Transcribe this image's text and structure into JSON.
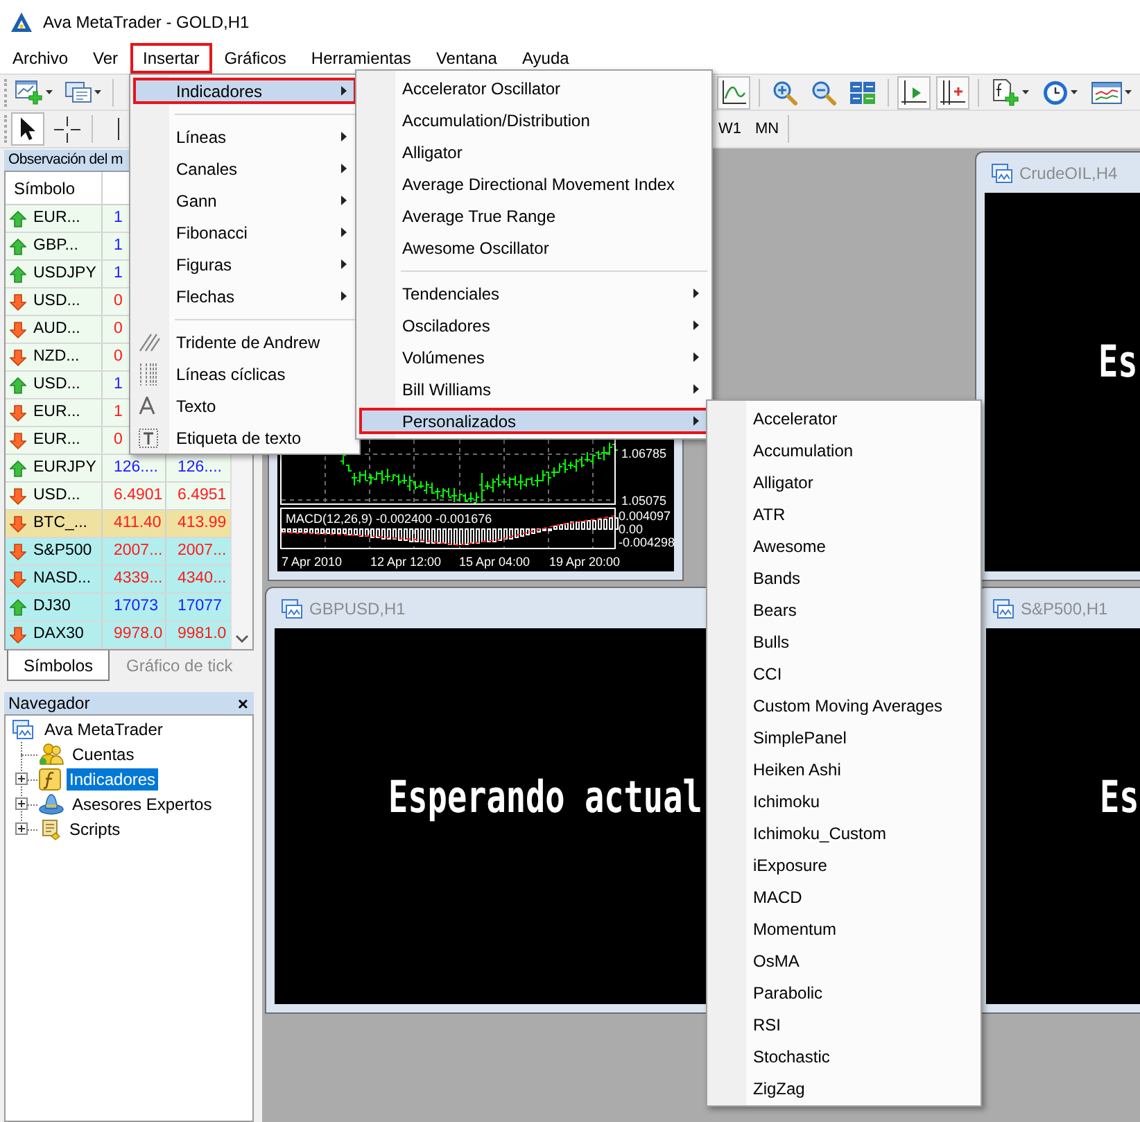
{
  "window": {
    "title": "Ava MetaTrader - GOLD,H1"
  },
  "menu_bar": [
    {
      "label": "Archivo",
      "selected": false
    },
    {
      "label": "Ver",
      "selected": false
    },
    {
      "label": "Insertar",
      "selected": true
    },
    {
      "label": "Gráficos",
      "selected": false
    },
    {
      "label": "Herramientas",
      "selected": false
    },
    {
      "label": "Ventana",
      "selected": false
    },
    {
      "label": "Ayuda",
      "selected": false
    }
  ],
  "toolbar": {
    "left": [
      {
        "kind": "new_chart",
        "on": false,
        "dropdown": true
      },
      {
        "kind": "profiles",
        "on": false,
        "dropdown": true
      },
      {
        "kind": "separator"
      }
    ],
    "right": [
      {
        "kind": "line_chart",
        "on": true,
        "dropdown": false
      },
      {
        "kind": "separator"
      },
      {
        "kind": "zoom_in",
        "on": false,
        "dropdown": false
      },
      {
        "kind": "zoom_out",
        "on": false,
        "dropdown": false
      },
      {
        "kind": "tile",
        "on": false,
        "dropdown": false
      },
      {
        "kind": "separator"
      },
      {
        "kind": "autoscroll",
        "on": true,
        "dropdown": false
      },
      {
        "kind": "chart_shift",
        "on": true,
        "dropdown": false
      },
      {
        "kind": "separator"
      },
      {
        "kind": "indicators",
        "on": false,
        "dropdown": true
      },
      {
        "kind": "periods",
        "on": false,
        "dropdown": true
      },
      {
        "kind": "templates",
        "on": false,
        "dropdown": true
      }
    ]
  },
  "tools_toolbar": {
    "tools": [
      {
        "kind": "cursor",
        "selected": true
      },
      {
        "kind": "crosshair",
        "selected": false
      },
      {
        "kind": "separator"
      },
      {
        "kind": "vertical_line",
        "selected": false
      }
    ],
    "timeframes": [
      {
        "label": "W1",
        "selected": false
      },
      {
        "label": "MN",
        "selected": false
      }
    ]
  },
  "market_watch": {
    "title": "Observación del m",
    "columns": [
      "Símbolo"
    ],
    "rows": [
      {
        "symbol": "EUR...",
        "rising": true,
        "bid": "1",
        "color": "#effaef"
      },
      {
        "symbol": "GBP...",
        "rising": true,
        "bid": "1",
        "color": "#effaef"
      },
      {
        "symbol": "USDJPY",
        "rising": true,
        "bid": "1",
        "color": "#effaef"
      },
      {
        "symbol": "USD...",
        "rising": false,
        "bid": "0",
        "color": "#effaef"
      },
      {
        "symbol": "AUD...",
        "rising": false,
        "bid": "0",
        "color": "#effaef"
      },
      {
        "symbol": "NZD...",
        "rising": false,
        "bid": "0",
        "color": "#effaef"
      },
      {
        "symbol": "USD...",
        "rising": true,
        "bid": "1",
        "color": "#effaef"
      },
      {
        "symbol": "EUR...",
        "rising": false,
        "bid": "1",
        "color": "#effaef"
      },
      {
        "symbol": "EUR...",
        "rising": false,
        "bid": "0",
        "color": "#effaef"
      },
      {
        "symbol": "EURJPY",
        "rising": true,
        "bid": "126....",
        "ask": "126....",
        "color": "#effaef"
      },
      {
        "symbol": "USD...",
        "rising": false,
        "bid": "6.4901",
        "ask": "6.4951",
        "color": "#effaef"
      },
      {
        "symbol": "BTC_...",
        "rising": false,
        "bid": "411.40",
        "ask": "413.99",
        "color": "#efe2a0"
      },
      {
        "symbol": "S&P500",
        "rising": false,
        "bid": "2007...",
        "ask": "2007...",
        "color": "#b3eeee"
      },
      {
        "symbol": "NASD...",
        "rising": false,
        "bid": "4339...",
        "ask": "4340...",
        "color": "#b3eeee"
      },
      {
        "symbol": "DJ30",
        "rising": true,
        "bid": "17073",
        "ask": "17077",
        "color": "#b3eeee"
      },
      {
        "symbol": "DAX30",
        "rising": false,
        "bid": "9978.0",
        "ask": "9981.0",
        "color": "#b3eeee"
      }
    ],
    "tabs": [
      {
        "label": "Símbolos",
        "selected": true
      },
      {
        "label": "Gráfico de tick",
        "selected": false
      }
    ]
  },
  "navigator": {
    "title": "Navegador",
    "close": "×",
    "tree": [
      {
        "label": "Ava MetaTrader",
        "kind": "terminal",
        "selected": false,
        "children": [
          {
            "label": "Cuentas",
            "kind": "accounts",
            "expandable": false,
            "selected": false
          },
          {
            "label": "Indicadores",
            "kind": "indicators",
            "expandable": true,
            "selected": true
          },
          {
            "label": "Asesores Expertos",
            "kind": "experts",
            "expandable": true,
            "selected": false
          },
          {
            "label": "Scripts",
            "kind": "scripts",
            "expandable": true,
            "selected": false
          }
        ]
      }
    ]
  },
  "charts": [
    {
      "kind": "chart",
      "price_labels": [
        "1.06785",
        "1.05075"
      ],
      "indicator": {
        "label": "MACD(12,26,9) -0.002400 -0.001676",
        "scale": [
          "0.004097",
          "0.00",
          "-0.004298"
        ]
      },
      "time_labels": [
        "7 Apr 2010",
        "12 Apr 12:00",
        "15 Apr 04:00",
        "19 Apr 20:00"
      ]
    },
    {
      "kind": "waiting",
      "title": "CrudeOIL,H4",
      "message": "Es"
    },
    {
      "kind": "waiting",
      "title": "GBPUSD,H1",
      "message": "Esperando actual"
    },
    {
      "kind": "waiting",
      "title": "S&P500,H1",
      "message": "Es"
    }
  ],
  "insert_menu": [
    {
      "kind": "submenu",
      "label": "Indicadores",
      "selected": true
    },
    {
      "kind": "separator"
    },
    {
      "kind": "submenu",
      "label": "Líneas",
      "selected": false
    },
    {
      "kind": "submenu",
      "label": "Canales",
      "selected": false
    },
    {
      "kind": "submenu",
      "label": "Gann",
      "selected": false
    },
    {
      "kind": "submenu",
      "label": "Fibonacci",
      "selected": false
    },
    {
      "kind": "submenu",
      "label": "Figuras",
      "selected": false
    },
    {
      "kind": "submenu",
      "label": "Flechas",
      "selected": false
    },
    {
      "kind": "separator"
    },
    {
      "kind": "pitchfork",
      "label": "Tridente de Andrew",
      "selected": false
    },
    {
      "kind": "cycle_lines",
      "label": "Líneas cíclicas",
      "selected": false
    },
    {
      "kind": "text",
      "label": "Texto",
      "selected": false
    },
    {
      "kind": "text_label",
      "label": "Etiqueta de texto",
      "selected": false
    }
  ],
  "indicators_menu": [
    {
      "kind": "item",
      "label": "Accelerator Oscillator",
      "selected": false
    },
    {
      "kind": "item",
      "label": "Accumulation/Distribution",
      "selected": false
    },
    {
      "kind": "item",
      "label": "Alligator",
      "selected": false
    },
    {
      "kind": "item",
      "label": "Average Directional Movement Index",
      "selected": false
    },
    {
      "kind": "item",
      "label": "Average True Range",
      "selected": false
    },
    {
      "kind": "item",
      "label": "Awesome Oscillator",
      "selected": false
    },
    {
      "kind": "separator"
    },
    {
      "kind": "submenu",
      "label": "Tendenciales",
      "selected": false
    },
    {
      "kind": "submenu",
      "label": "Osciladores",
      "selected": false
    },
    {
      "kind": "submenu",
      "label": "Volúmenes",
      "selected": false
    },
    {
      "kind": "submenu",
      "label": "Bill Williams",
      "selected": false
    },
    {
      "kind": "submenu",
      "label": "Personalizados",
      "selected": true
    }
  ],
  "custom_indicators_menu": [
    {
      "label": "Accelerator",
      "selected": false
    },
    {
      "label": "Accumulation",
      "selected": false
    },
    {
      "label": "Alligator",
      "selected": false
    },
    {
      "label": "ATR",
      "selected": false
    },
    {
      "label": "Awesome",
      "selected": false
    },
    {
      "label": "Bands",
      "selected": false
    },
    {
      "label": "Bears",
      "selected": false
    },
    {
      "label": "Bulls",
      "selected": false
    },
    {
      "label": "CCI",
      "selected": false
    },
    {
      "label": "Custom Moving Averages",
      "selected": false
    },
    {
      "label": "SimplePanel",
      "selected": false
    },
    {
      "label": "Heiken Ashi",
      "selected": false
    },
    {
      "label": "Ichimoku",
      "selected": false
    },
    {
      "label": "Ichimoku_Custom",
      "selected": false
    },
    {
      "label": "iExposure",
      "selected": false
    },
    {
      "label": "MACD",
      "selected": false
    },
    {
      "label": "Momentum",
      "selected": false
    },
    {
      "label": "OsMA",
      "selected": false
    },
    {
      "label": "Parabolic",
      "selected": false
    },
    {
      "label": "RSI",
      "selected": false
    },
    {
      "label": "Stochastic",
      "selected": false
    },
    {
      "label": "ZigZag",
      "selected": false
    }
  ]
}
